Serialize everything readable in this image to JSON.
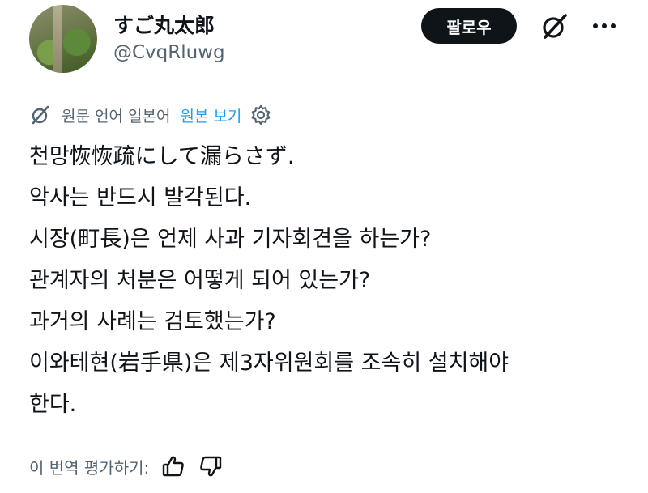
{
  "profile": {
    "display_name": "すご丸太郎",
    "handle": "@CvqRluwg"
  },
  "actions": {
    "follow_label": "팔로우",
    "grok_icon": "grok-slash-icon",
    "more_icon": "more-dots-icon"
  },
  "translation": {
    "source_label": "원문 언어 일본어",
    "show_original_label": "원본 보기",
    "settings_icon": "gear-icon"
  },
  "tweet": {
    "lines": [
      "천망恢恢疏にして漏らさず.",
      "악사는 반드시 발각된다.",
      "시장(町長)은 언제 사과 기자회견을 하는가?",
      "관계자의 처분은 어떻게 되어 있는가?",
      "과거의 사례는 검토했는가?",
      "이와테현(岩手県)은 제3자위원회를 조속히 설치해야",
      "한다."
    ]
  },
  "rating": {
    "label": "이 번역 평가하기:",
    "thumbs_up_icon": "thumbs-up-icon",
    "thumbs_down_icon": "thumbs-down-icon"
  },
  "colors": {
    "text_primary": "#0f1419",
    "text_secondary": "#536471",
    "link": "#1d9bf0",
    "button_bg": "#0f1419"
  }
}
